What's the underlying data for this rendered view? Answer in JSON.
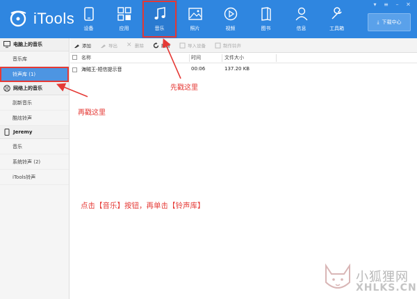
{
  "app": {
    "title": "iTools",
    "accent": "#2f86e0",
    "annotation_color": "#e53935"
  },
  "nav": {
    "items": [
      {
        "label": "设备",
        "icon": "phone-icon"
      },
      {
        "label": "应用",
        "icon": "apps-grid-icon"
      },
      {
        "label": "音乐",
        "icon": "music-note-icon"
      },
      {
        "label": "照片",
        "icon": "picture-icon"
      },
      {
        "label": "视频",
        "icon": "play-icon"
      },
      {
        "label": "图书",
        "icon": "book-icon"
      },
      {
        "label": "信息",
        "icon": "user-icon"
      },
      {
        "label": "工具箱",
        "icon": "wrench-icon"
      }
    ],
    "download_label": "下载中心"
  },
  "sidebar": {
    "section_pc": "电脑上的音乐",
    "pc_items": [
      "音乐库",
      "铃声库 (1)"
    ],
    "section_online": "网络上的音乐",
    "online_items": [
      "刮新音乐",
      "酷炫铃声"
    ],
    "section_device": "Jeremy",
    "device_items": [
      "音乐",
      "系统铃声 (2)",
      "iTools铃声"
    ]
  },
  "toolbar": {
    "add": "添加",
    "export": "导出",
    "delete": "删除",
    "refresh": "刷新",
    "import_device": "导入设备",
    "make_ringtone": "制作铃声"
  },
  "table": {
    "columns": [
      "名称",
      "时间",
      "文件大小"
    ],
    "rows": [
      {
        "name": "海贼王-短信提示音",
        "time": "00:06",
        "size": "137.20 KB"
      }
    ]
  },
  "annotations": {
    "first": "先戳这里",
    "second": "再戳这里",
    "instruction": "点击【音乐】按钮，再单击【铃声库】"
  },
  "watermark": {
    "brand": "小狐狸网",
    "domain": "XHLKS.CN"
  }
}
